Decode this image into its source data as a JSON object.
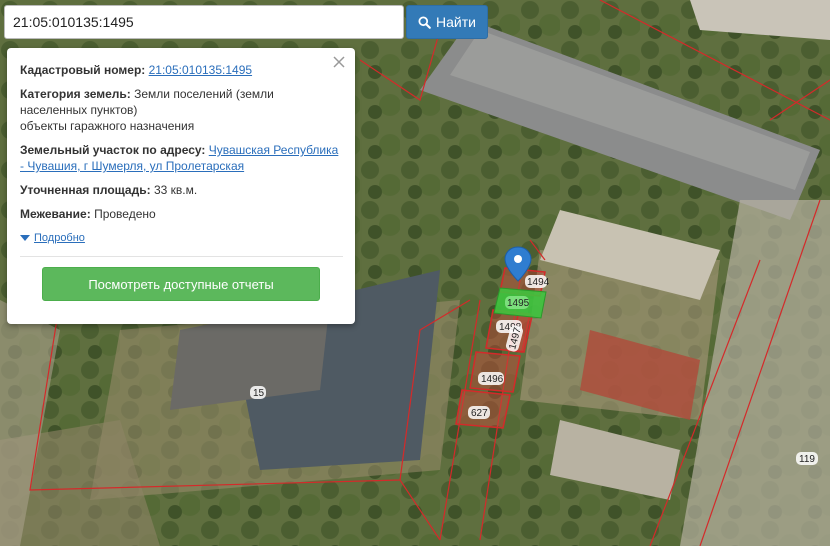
{
  "search": {
    "value": "21:05:010135:1495",
    "button_label": "Найти"
  },
  "popup": {
    "cadastral_label": "Кадастровый номер:",
    "cadastral_value": "21:05:010135:1495",
    "category_label": "Категория земель:",
    "category_value_1": "Земли поселений (земли",
    "category_value_2": "населенных пунктов)",
    "category_value_3": "объекты гаражного назначения",
    "address_label": "Земельный участок по адресу:",
    "address_value_1": "Чувашская Республика",
    "address_value_2": "- Чувашия, г Шумерля, ул Пролетарская",
    "area_label": "Уточненная площадь:",
    "area_value": "33 кв.м.",
    "survey_label": "Межевание:",
    "survey_value": "Проведено",
    "details_link": "Подробно",
    "reports_button": "Посмотреть доступные отчеты"
  },
  "map": {
    "parcel_labels": [
      "1494",
      "1495",
      "1498",
      "1497",
      "1496",
      "627",
      "15",
      "119"
    ],
    "colors": {
      "parcel_outline": "#d42a2a",
      "selected_parcel": "#3ec43e",
      "marker": "#2f7dd0"
    }
  }
}
